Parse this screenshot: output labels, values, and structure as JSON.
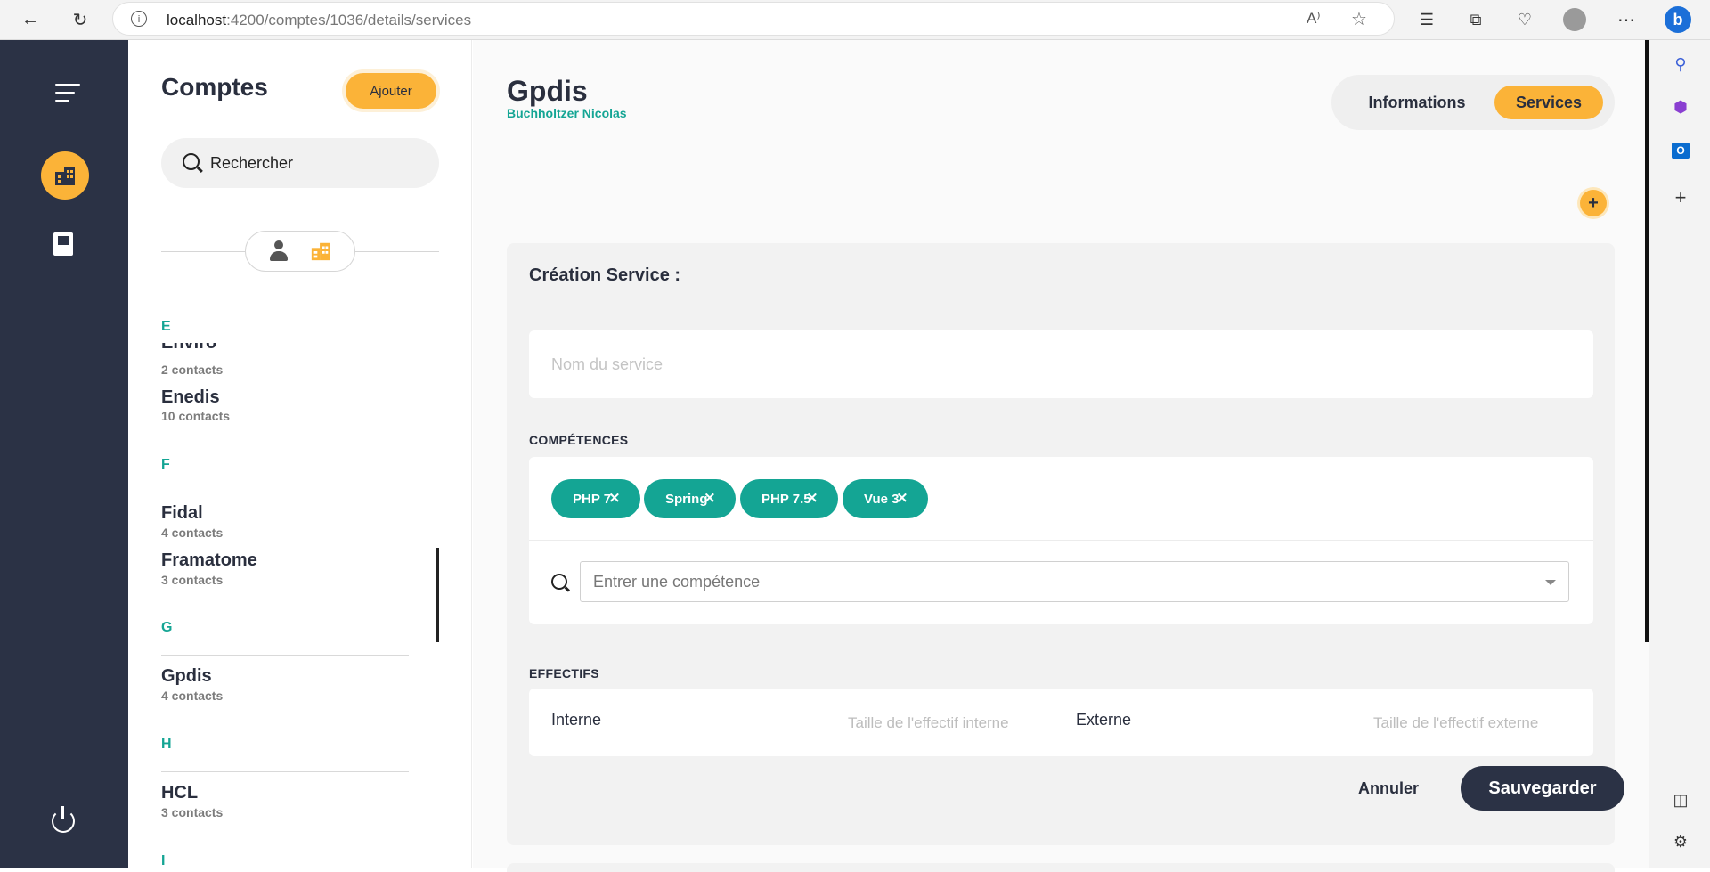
{
  "browser": {
    "url_host": "localhost",
    "url_path": ":4200/comptes/1036/details/services",
    "read_aloud": "A⁾"
  },
  "list": {
    "title": "Comptes",
    "add_label": "Ajouter",
    "search_placeholder": "Rechercher",
    "groups": [
      {
        "letter": "E",
        "items": [
          {
            "name": "Enviro",
            "sub": "2 contacts"
          },
          {
            "name": "Enedis",
            "sub": "10 contacts"
          }
        ]
      },
      {
        "letter": "F",
        "items": [
          {
            "name": "Fidal",
            "sub": "4 contacts"
          },
          {
            "name": "Framatome",
            "sub": "3 contacts"
          }
        ]
      },
      {
        "letter": "G",
        "items": [
          {
            "name": "Gpdis",
            "sub": "4 contacts"
          }
        ]
      },
      {
        "letter": "H",
        "items": [
          {
            "name": "HCL",
            "sub": "3 contacts"
          }
        ]
      },
      {
        "letter": "I",
        "items": []
      }
    ]
  },
  "account": {
    "title": "Gpdis",
    "owner": "Buchholtzer Nicolas"
  },
  "tabs": {
    "informations": "Informations",
    "services": "Services",
    "active": "services"
  },
  "form": {
    "title": "Création Service :",
    "name_placeholder": "Nom du service",
    "skills_label": "COMPÉTENCES",
    "skills": [
      "PHP 7",
      "Spring",
      "PHP 7.5",
      "Vue 3"
    ],
    "skill_placeholder": "Entrer une compétence",
    "staff_label": "EFFECTIFS",
    "internal_label": "Interne",
    "internal_placeholder": "Taille de l'effectif interne",
    "external_label": "Externe",
    "external_placeholder": "Taille de l'effectif externe",
    "cancel_label": "Annuler",
    "save_label": "Sauvegarder"
  },
  "colors": {
    "accent": "#fbb338",
    "teal": "#14a594",
    "nav": "#2b3245"
  }
}
